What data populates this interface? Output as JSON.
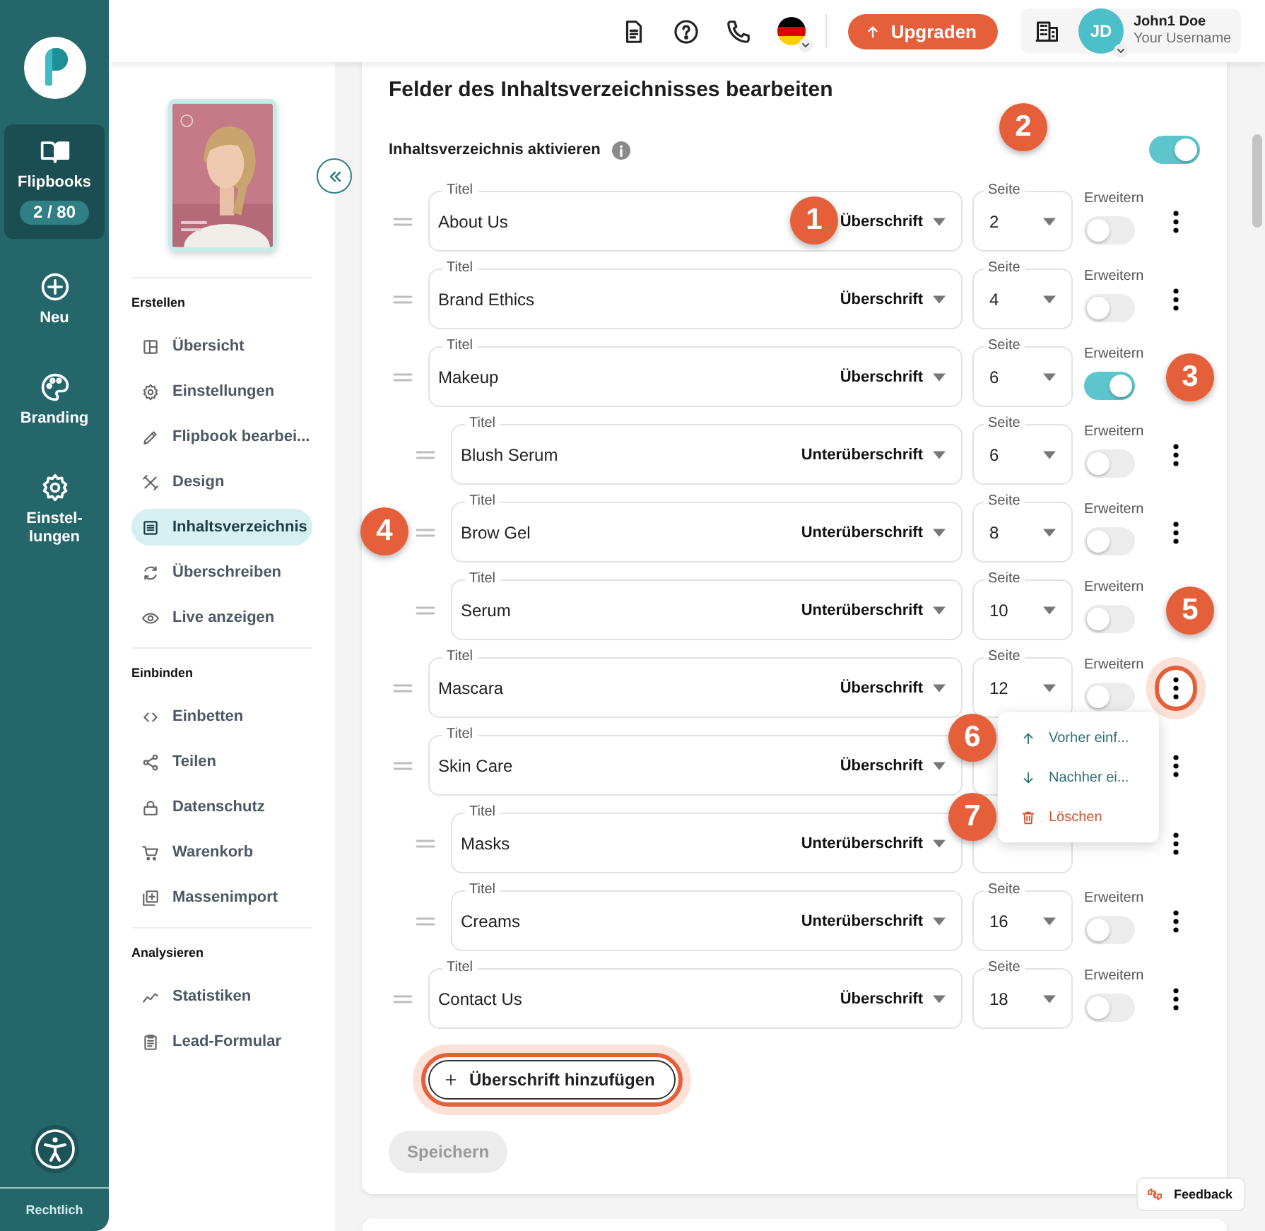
{
  "rail": {
    "items": [
      {
        "kind": "book",
        "label": "Flipbooks",
        "count": "2 / 80",
        "selected": true
      },
      {
        "kind": "plus",
        "label": "Neu",
        "selected": false
      },
      {
        "kind": "palette",
        "label": "Branding",
        "selected": false
      },
      {
        "kind": "gear",
        "label": "Einstel-lungen",
        "selected": false
      }
    ],
    "footer": "Rechtlich"
  },
  "topbar": {
    "icons": [
      {
        "kind": "document"
      },
      {
        "kind": "help"
      },
      {
        "kind": "phone"
      }
    ],
    "upgrade": "Upgraden",
    "user": {
      "initials": "JD",
      "name": "John1 Doe",
      "username": "Your Username"
    }
  },
  "sidenav": {
    "sections": [
      {
        "title": "Erstellen",
        "items": [
          {
            "kind": "layout",
            "label": "Übersicht",
            "selected": false
          },
          {
            "kind": "gear",
            "label": "Einstellungen",
            "selected": false
          },
          {
            "kind": "pencil",
            "label": "Flipbook bearbei...",
            "selected": false
          },
          {
            "kind": "tools",
            "label": "Design",
            "selected": false
          },
          {
            "kind": "toc",
            "label": "Inhaltsverzeichnis",
            "selected": true
          },
          {
            "kind": "refresh",
            "label": "Überschreiben",
            "selected": false
          },
          {
            "kind": "eye",
            "label": "Live anzeigen",
            "selected": false
          }
        ]
      },
      {
        "title": "Einbinden",
        "items": [
          {
            "kind": "code",
            "label": "Einbetten",
            "selected": false
          },
          {
            "kind": "share",
            "label": "Teilen",
            "selected": false
          },
          {
            "kind": "lock",
            "label": "Datenschutz",
            "selected": false
          },
          {
            "kind": "cart",
            "label": "Warenkorb",
            "selected": false
          },
          {
            "kind": "import",
            "label": "Massenimport",
            "selected": false
          }
        ]
      },
      {
        "title": "Analysieren",
        "items": [
          {
            "kind": "stats",
            "label": "Statistiken",
            "selected": false
          },
          {
            "kind": "clipboard",
            "label": "Lead-Formular",
            "selected": false
          }
        ]
      }
    ]
  },
  "editor": {
    "title": "Felder des Inhaltsverzeichnisses bearbeiten",
    "toc_toggle": {
      "label": "Inhaltsverzeichnis aktivieren",
      "on": true,
      "marker": "2"
    },
    "rows": [
      {
        "kind": "heading",
        "title_label": "Titel",
        "title": "About Us",
        "type": "Überschrift",
        "page_label": "Seite",
        "page": "2",
        "expand_label": "Erweitern",
        "expand": false,
        "marker": {
          "label": "1",
          "kind": "type"
        }
      },
      {
        "kind": "heading",
        "title_label": "Titel",
        "title": "Brand Ethics",
        "type": "Überschrift",
        "page_label": "Seite",
        "page": "4",
        "expand_label": "Erweitern",
        "expand": false
      },
      {
        "kind": "heading",
        "title_label": "Titel",
        "title": "Makeup",
        "type": "Überschrift",
        "page_label": "Seite",
        "page": "6",
        "expand_label": "Erweitern",
        "expand": true,
        "marker": {
          "label": "3",
          "kind": "kebab"
        }
      },
      {
        "kind": "subheading",
        "title_label": "Titel",
        "title": "Blush Serum",
        "type": "Unterüberschrift",
        "page_label": "Seite",
        "page": "6",
        "expand_label": "Erweitern",
        "expand": false
      },
      {
        "kind": "subheading",
        "title_label": "Titel",
        "title": "Brow Gel",
        "type": "Unterüberschrift",
        "page_label": "Seite",
        "page": "8",
        "expand_label": "Erweitern",
        "expand": false,
        "marker": {
          "label": "4",
          "kind": "handle"
        }
      },
      {
        "kind": "subheading",
        "title_label": "Titel",
        "title": "Serum",
        "type": "Unterüberschrift",
        "page_label": "Seite",
        "page": "10",
        "expand_label": "Erweitern",
        "expand": false,
        "marker": {
          "label": "5",
          "kind": "kebab"
        }
      },
      {
        "kind": "heading",
        "title_label": "Titel",
        "title": "Mascara",
        "type": "Überschrift",
        "page_label": "Seite",
        "page": "12",
        "expand_label": "Erweitern",
        "expand": false,
        "highlighted": true,
        "menu": [
          {
            "kind": "before",
            "label": "Vorher einf...",
            "marker": "6"
          },
          {
            "kind": "after",
            "label": "Nachher ei..."
          },
          {
            "kind": "delete",
            "label": "Löschen",
            "marker": "7"
          }
        ]
      },
      {
        "kind": "heading",
        "title_label": "Titel",
        "title": "Skin Care",
        "type": "Überschrift"
      },
      {
        "kind": "subheading",
        "title_label": "Titel",
        "title": "Masks",
        "type": "Unterüberschrift"
      },
      {
        "kind": "subheading",
        "title_label": "Titel",
        "title": "Creams",
        "type": "Unterüberschrift",
        "page_label": "Seite",
        "page": "16",
        "expand_label": "Erweitern",
        "expand": false
      },
      {
        "kind": "heading",
        "title_label": "Titel",
        "title": "Contact Us",
        "type": "Überschrift",
        "page_label": "Seite",
        "page": "18",
        "expand_label": "Erweitern",
        "expand": false
      }
    ],
    "add_button": {
      "label": "Überschrift hinzufügen",
      "highlighted": true
    },
    "save_button": {
      "label": "Speichern",
      "disabled": true
    }
  },
  "feedback": "Feedback"
}
